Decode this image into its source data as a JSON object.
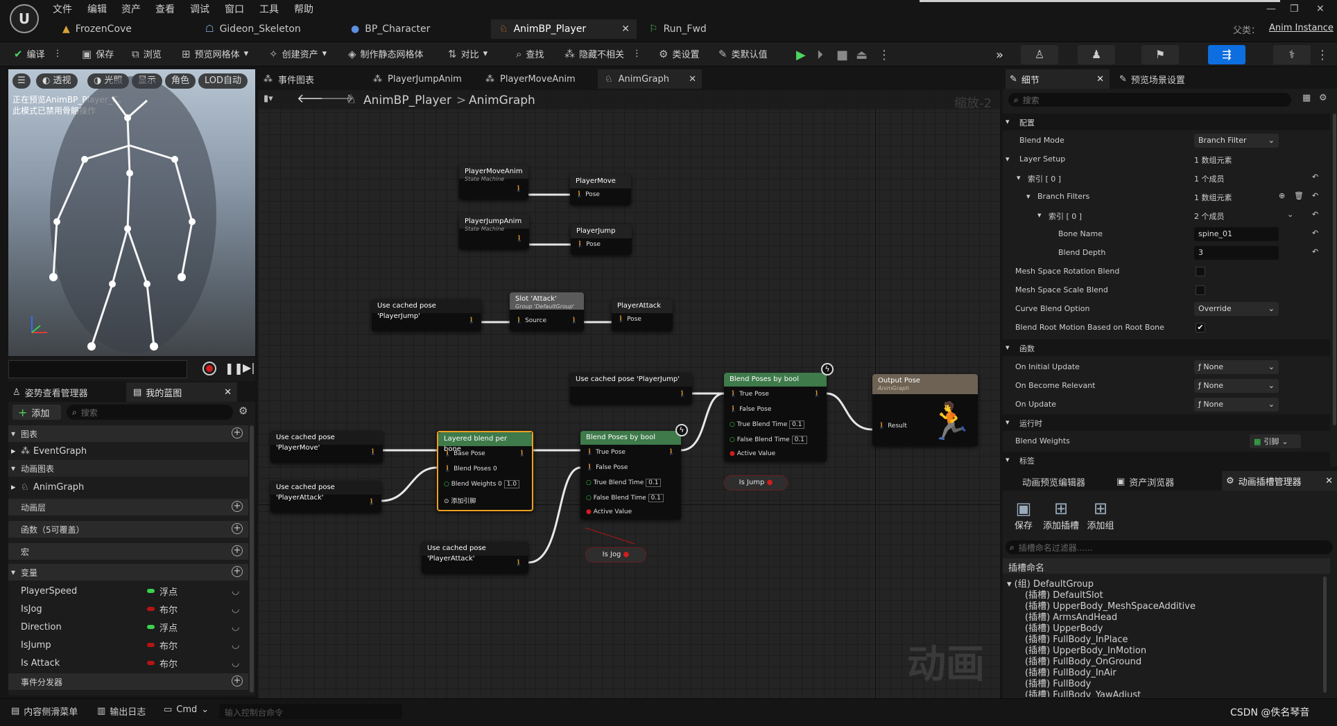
{
  "menu": {
    "items": [
      "文件",
      "编辑",
      "资产",
      "查看",
      "调试",
      "窗口",
      "工具",
      "帮助"
    ]
  },
  "asset_tabs": [
    {
      "label": "FrozenCove"
    },
    {
      "label": "Gideon_Skeleton"
    },
    {
      "label": "BP_Character"
    },
    {
      "label": "AnimBP_Player"
    },
    {
      "label": "Run_Fwd"
    }
  ],
  "parent_class": {
    "label": "父类：",
    "value": "Anim Instance"
  },
  "toolbar": {
    "compile": "编译",
    "save": "保存",
    "browse": "浏览",
    "preview_mesh": "预览网格体",
    "create_asset": "创建资产",
    "make_static_mesh": "制作静态网格体",
    "diff": "对比",
    "find": "查找",
    "hide_unrelated": "隐藏不相关",
    "class_settings": "类设置",
    "class_defaults": "类默认值"
  },
  "viewport": {
    "perspective": "透视",
    "lit": "光照",
    "show": "显示",
    "character": "角色",
    "lod": "LOD自动",
    "notice_line1": "正在预览AnimBP_Player_C。",
    "notice_line2": "此模式已禁用骨骼操作"
  },
  "left_panel": {
    "tabs": {
      "pose_watch": "姿势查看管理器",
      "my_blueprint": "我的蓝图"
    },
    "add_label": "添加",
    "search_placeholder": "搜索",
    "sections": {
      "graphs": "图表",
      "event_graph": "EventGraph",
      "anim_graphs": "动画图表",
      "anim_graph": "AnimGraph",
      "anim_layers": "动画层",
      "functions": "函数（5可覆盖）",
      "macros": "宏",
      "variables": "变量",
      "event_dispatchers": "事件分发器"
    },
    "variables": [
      {
        "name": "PlayerSpeed",
        "type": "浮点",
        "color": "#3ad14f"
      },
      {
        "name": "IsJog",
        "type": "布尔",
        "color": "#b51414"
      },
      {
        "name": "Direction",
        "type": "浮点",
        "color": "#3ad14f"
      },
      {
        "name": "IsJump",
        "type": "布尔",
        "color": "#b51414"
      },
      {
        "name": "Is Attack",
        "type": "布尔",
        "color": "#b51414"
      }
    ]
  },
  "graph_tabs": [
    {
      "label": "事件图表"
    },
    {
      "label": "PlayerJumpAnim"
    },
    {
      "label": "PlayerMoveAnim"
    },
    {
      "label": "AnimGraph"
    }
  ],
  "breadcrumb": {
    "root": "AnimBP_Player",
    "separator": ">",
    "current": "AnimGraph",
    "zoom": "缩放-2"
  },
  "graph": {
    "watermark": "动画",
    "nodes": {
      "sm_move": {
        "title": "PlayerMoveAnim",
        "sub": "State Machine"
      },
      "cache_move": {
        "title": "PlayerMove",
        "pin": "Pose"
      },
      "sm_jump": {
        "title": "PlayerJumpAnim",
        "sub": "State Machine"
      },
      "cache_jump": {
        "title": "PlayerJump",
        "pin": "Pose"
      },
      "use_jump1": {
        "title": "Use cached pose 'PlayerJump'"
      },
      "slot": {
        "title": "Slot 'Attack'",
        "sub": "Group 'DefaultGroup'",
        "pin": "Source"
      },
      "cache_attack": {
        "title": "PlayerAttack",
        "pin": "Pose"
      },
      "use_jump2": {
        "title": "Use cached pose 'PlayerJump'"
      },
      "use_move": {
        "title": "Use cached pose 'PlayerMove'"
      },
      "use_attack1": {
        "title": "Use cached pose 'PlayerAttack'"
      },
      "use_attack2": {
        "title": "Use cached pose 'PlayerAttack'"
      },
      "layered": {
        "title": "Layered blend per bone",
        "base": "Base Pose",
        "blend0": "Blend Poses 0",
        "weights": "Blend Weights 0",
        "weights_val": "1.0",
        "add_pin": "添加引脚"
      },
      "blend1": {
        "title": "Blend Poses by bool",
        "true_pose": "True Pose",
        "false_pose": "False Pose",
        "true_time": "True Blend Time",
        "true_val": "0.1",
        "false_time": "False Blend Time",
        "false_val": "0.1",
        "active": "Active Value"
      },
      "blend2": {
        "title": "Blend Poses by bool",
        "true_pose": "True Pose",
        "false_pose": "False Pose",
        "true_time": "True Blend Time",
        "true_val": "0.1",
        "false_time": "False Blend Time",
        "false_val": "0.1",
        "active": "Active Value"
      },
      "output": {
        "title": "Output Pose",
        "sub": "AnimGraph",
        "pin": "Result"
      },
      "isjog": {
        "title": "Is Jog"
      },
      "isjump": {
        "title": "Is Jump"
      }
    }
  },
  "details": {
    "tabs": {
      "details": "细节",
      "preview_scene": "预览场景设置"
    },
    "search_placeholder": "搜索",
    "rows": {
      "config": "配置",
      "blend_mode": "Blend Mode",
      "blend_mode_val": "Branch Filter",
      "layer_setup": "Layer Setup",
      "layer_setup_val": "1 数组元素",
      "index0": "索引 [ 0 ]",
      "index0_val": "1 个成员",
      "branch_filters": "Branch Filters",
      "branch_filters_val": "1 数组元素",
      "index0b": "索引 [ 0 ]",
      "index0b_val": "2 个成员",
      "bone_name": "Bone Name",
      "bone_name_val": "spine_01",
      "blend_depth": "Blend Depth",
      "blend_depth_val": "3",
      "mesh_rot": "Mesh Space Rotation Blend",
      "mesh_scale": "Mesh Space Scale Blend",
      "curve_blend": "Curve Blend Option",
      "curve_blend_val": "Override",
      "root_motion": "Blend Root Motion Based on Root Bone",
      "functions": "函数",
      "on_initial": "On Initial Update",
      "on_relevant": "On Become Relevant",
      "on_update": "On Update",
      "none": "None",
      "runtime": "运行时",
      "blend_weights": "Blend Weights",
      "blend_weights_val": "引脚",
      "tags": "标签"
    }
  },
  "slot_panel": {
    "tabs": {
      "preview_editor": "动画预览编辑器",
      "asset_browser": "资产浏览器",
      "slot_manager": "动画插槽管理器"
    },
    "buttons": {
      "save": "保存",
      "add_slot": "添加插槽",
      "add_group": "添加组"
    },
    "filter_placeholder": "插槽命名过滤器......",
    "header": "插槽命名",
    "group": "(组) DefaultGroup",
    "slots": [
      "(插槽) DefaultSlot",
      "(插槽) UpperBody_MeshSpaceAdditive",
      "(插槽) ArmsAndHead",
      "(插槽) UpperBody",
      "(插槽) FullBody_InPlace",
      "(插槽) UpperBody_InMotion",
      "(插槽) FullBody_OnGround",
      "(插槽) FullBody_InAir",
      "(插槽) FullBody",
      "(插槽) FullBody_YawAdjust"
    ]
  },
  "status": {
    "content_drawer": "内容侧滑菜单",
    "output_log": "输出日志",
    "cmd": "Cmd",
    "console_placeholder": "输入控制台命令",
    "watermark": "CSDN @佚名琴音"
  }
}
